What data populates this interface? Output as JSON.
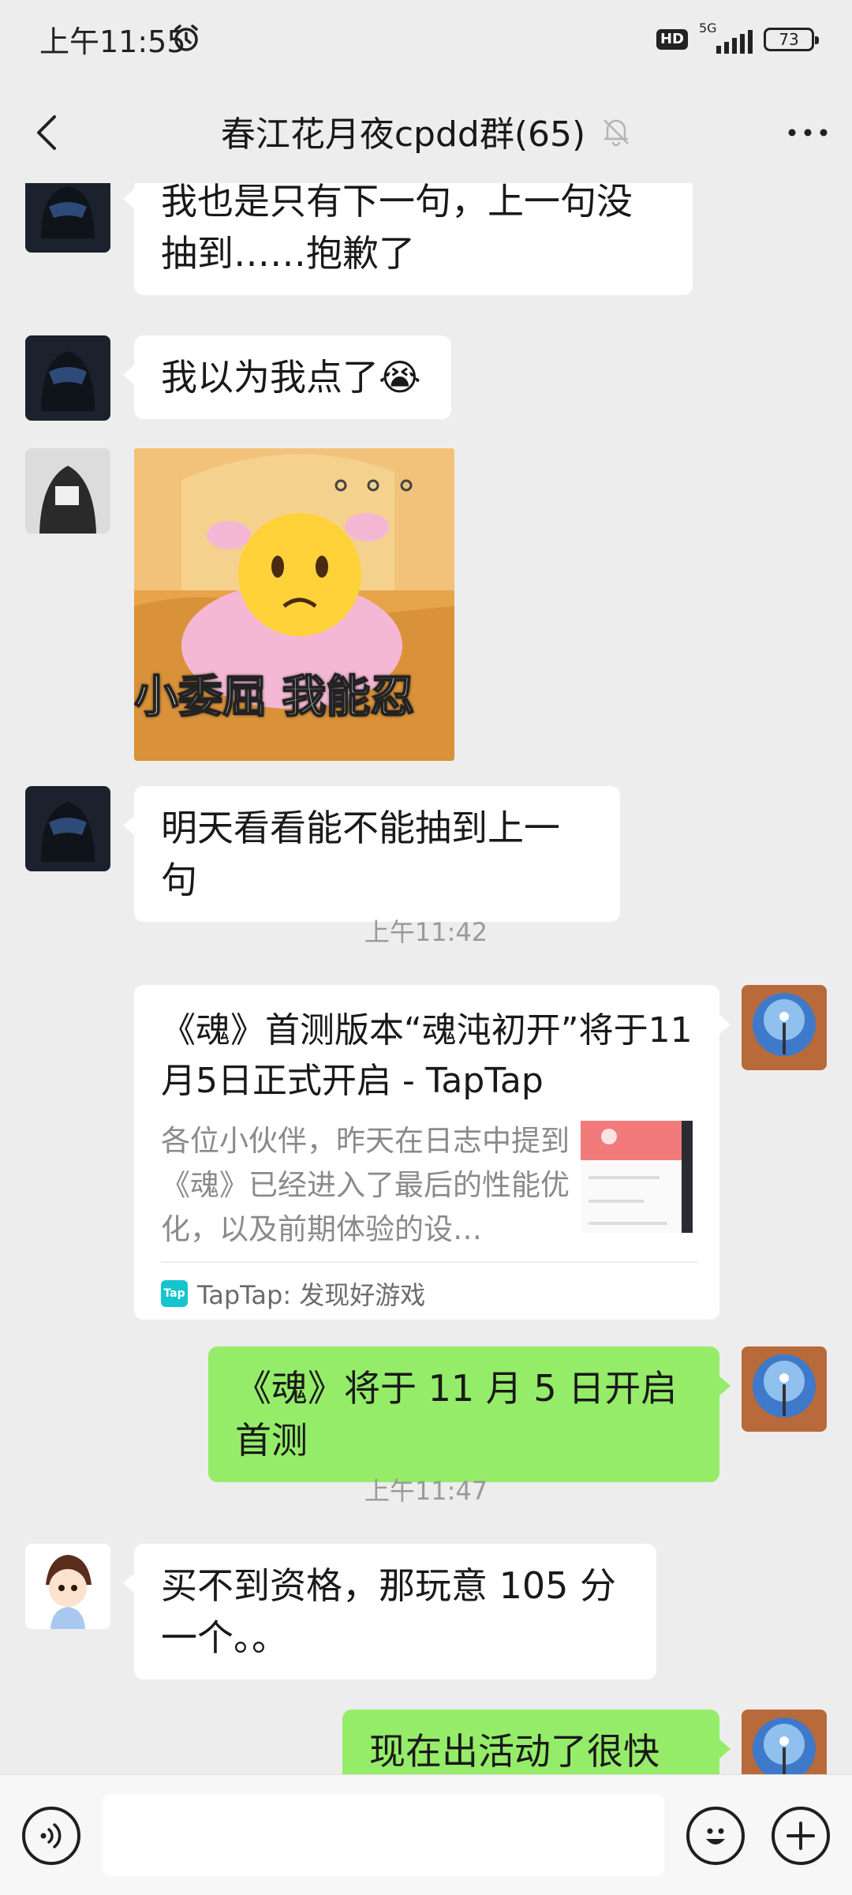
{
  "status_bar": {
    "time": "上午11:55",
    "hd": "HD",
    "network": "5G",
    "battery": "73"
  },
  "nav": {
    "title": "春江花月夜cpdd群(65)"
  },
  "messages": [
    {
      "text": "我也是只有下一句，上一句没抽到……抱歉了"
    },
    {
      "text": "我以为我点了",
      "emoji": "😭"
    },
    {
      "sticker_caption": "小委屈 我能忍"
    },
    {
      "text": "明天看看能不能抽到上一句"
    },
    {
      "text": "《魂》将于 11 月 5 日开启首测"
    },
    {
      "text": "买不到资格，那玩意 105 分一个。。"
    },
    {
      "text": "现在出活动了很快的"
    }
  ],
  "timestamps": [
    "上午11:42",
    "上午11:47"
  ],
  "link_card": {
    "title": "《魂》首测版本“魂沌初开”将于11月5日正式开启 - TapTap",
    "description": "各位小伙伴，昨天在日志中提到《魂》已经进入了最后的性能优化，以及前期体验的设…",
    "source_icon": "Tap",
    "source": "TapTap: 发现好游戏"
  }
}
